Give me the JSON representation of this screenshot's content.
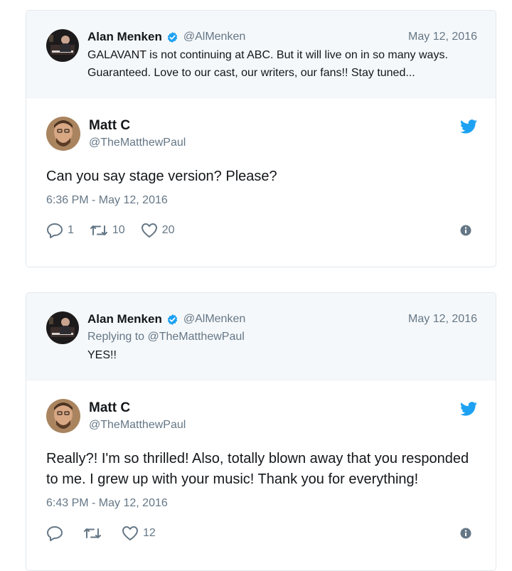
{
  "colors": {
    "twitter_blue": "#1da1f2",
    "secondary_text": "#657786",
    "primary_text": "#14171a",
    "parent_bg": "#f5f8fa",
    "border": "#e1e8ed"
  },
  "tweets": [
    {
      "parent": {
        "author_name": "Alan Menken",
        "handle": "@AlMenken",
        "date": "May 12, 2016",
        "replying_to": "",
        "text": "GALAVANT is not continuing at ABC. But it will live on in so many ways. Guaranteed. Love to our cast, our writers, our fans!! Stay tuned..."
      },
      "reply": {
        "author_name": "Matt C",
        "handle": "@TheMatthewPaul",
        "text": "Can you say stage version? Please?",
        "timestamp": "6:36 PM - May 12, 2016",
        "replies": "1",
        "retweets": "10",
        "likes": "20"
      }
    },
    {
      "parent": {
        "author_name": "Alan Menken",
        "handle": "@AlMenken",
        "date": "May 12, 2016",
        "replying_to": "Replying to @TheMatthewPaul",
        "text": "YES!!"
      },
      "reply": {
        "author_name": "Matt C",
        "handle": "@TheMatthewPaul",
        "text": "Really?! I'm so thrilled! Also, totally blown away that you responded to me. I grew up with your music! Thank you for everything!",
        "timestamp": "6:43 PM - May 12, 2016",
        "replies": "",
        "retweets": "",
        "likes": "12"
      }
    }
  ]
}
